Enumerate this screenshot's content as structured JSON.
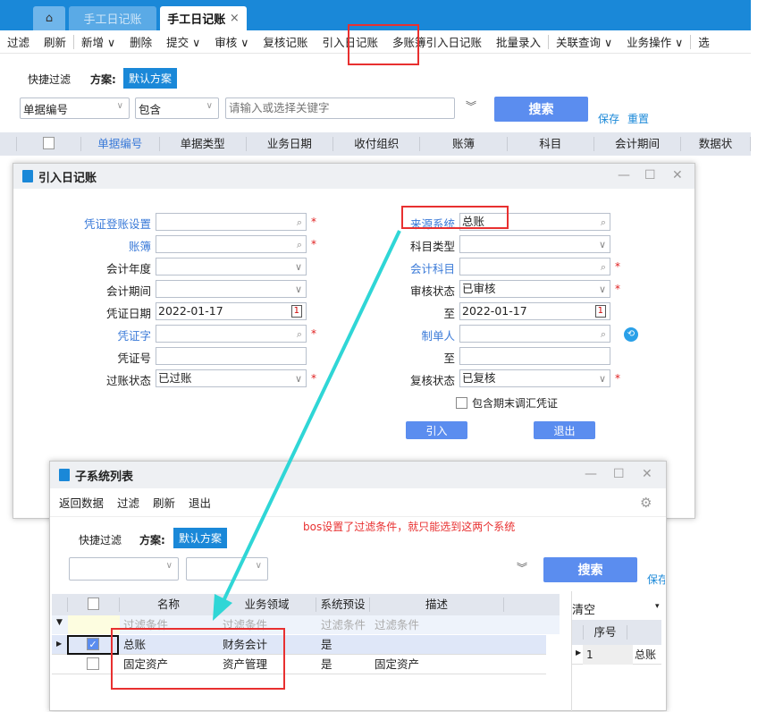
{
  "tabs": {
    "home_icon": "home-icon",
    "tab1": "手工日记账",
    "tab2": "手工日记账",
    "close": "×"
  },
  "toolbar": [
    "过滤",
    "刷新",
    "|",
    "新增 ∨",
    "删除",
    "提交 ∨",
    "审核 ∨",
    "复核记账",
    "引入日记账",
    "多账簿引入日记账",
    "批量录入",
    "|",
    "关联查询 ∨",
    "业务操作 ∨",
    "|",
    "选"
  ],
  "filter": {
    "quick": "快捷过滤",
    "scheme_label": "方案:",
    "scheme": "默认方案",
    "field": "单据编号",
    "op": "包含",
    "keyword_placeholder": "请输入或选择关键字",
    "expand": "︾",
    "search": "搜索",
    "save": "保存",
    "reset": "重置"
  },
  "grid_headers": [
    "单据编号",
    "单据类型",
    "业务日期",
    "收付组织",
    "账簿",
    "科目",
    "会计期间",
    "数据状"
  ],
  "dialog1": {
    "title": "引入日记账",
    "left": [
      {
        "label": "凭证登账设置",
        "value": "",
        "link": true,
        "req": true,
        "icon": "search"
      },
      {
        "label": "账簿",
        "value": "",
        "link": true,
        "req": true,
        "icon": "search"
      },
      {
        "label": "会计年度",
        "value": "",
        "icon": "chevron"
      },
      {
        "label": "会计期间",
        "value": "",
        "icon": "chevron"
      },
      {
        "label": "凭证日期",
        "value": "2022-01-17",
        "icon": "calendar"
      },
      {
        "label": "凭证字",
        "value": "",
        "link": true,
        "req": true,
        "icon": "search"
      },
      {
        "label": "凭证号",
        "value": ""
      },
      {
        "label": "过账状态",
        "value": "已过账",
        "req": true,
        "icon": "chevron"
      }
    ],
    "right": [
      {
        "label": "来源系统",
        "value": "总账",
        "link": true,
        "icon": "search"
      },
      {
        "label": "科目类型",
        "value": "",
        "icon": "chevron"
      },
      {
        "label": "会计科目",
        "value": "",
        "link": true,
        "req": true,
        "icon": "search"
      },
      {
        "label": "审核状态",
        "value": "已审核",
        "req": true,
        "icon": "chevron"
      },
      {
        "label": "至",
        "value": "2022-01-17",
        "icon": "calendar"
      },
      {
        "label": "制单人",
        "value": "",
        "link": true,
        "icon": "search"
      },
      {
        "label": "至",
        "value": ""
      },
      {
        "label": "复核状态",
        "value": "已复核",
        "req": true,
        "icon": "chevron"
      }
    ],
    "checkbox": "包含期末调汇凭证",
    "import": "引入",
    "exit": "退出"
  },
  "dialog2": {
    "title": "子系统列表",
    "menu": [
      "返回数据",
      "过滤",
      "刷新",
      "退出"
    ],
    "note": "bos设置了过滤条件，就只能选到这两个系统",
    "note_color": "#e83030",
    "quick": "快捷过滤",
    "scheme_label": "方案:",
    "scheme": "默认方案",
    "search": "搜索",
    "save_partial": "保存",
    "headers": [
      "名称",
      "业务领域",
      "系统预设",
      "描述"
    ],
    "filter_row": [
      "过滤条件",
      "过滤条件",
      "过滤条件",
      "过滤条件"
    ],
    "rows": [
      {
        "checked": true,
        "cells": [
          "总账",
          "财务会计",
          "是",
          ""
        ]
      },
      {
        "checked": false,
        "cells": [
          "固定资产",
          "资产管理",
          "是",
          "固定资产"
        ]
      }
    ],
    "side": {
      "clear": "清空",
      "header": "序号",
      "row": [
        "1",
        "总账"
      ]
    }
  },
  "colors": {
    "accent": "#1a88d8",
    "button": "#5b8def",
    "highlight": "#e83030",
    "arrow": "#2fd6d6"
  }
}
